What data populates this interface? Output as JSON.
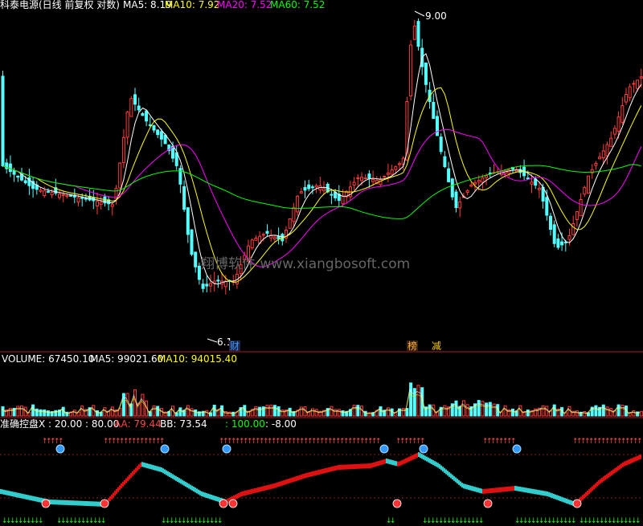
{
  "header": {
    "main_title": "科泰电源(日线 前复权 对数)",
    "ma": [
      {
        "label": "MA5: 8.19",
        "color": "#ffffff"
      },
      {
        "label": "MA10: 7.92",
        "color": "#ffff00"
      },
      {
        "label": "MA20: 7.52",
        "color": "#ff00ff"
      },
      {
        "label": "MA60: 7.52",
        "color": "#00ff00"
      }
    ]
  },
  "volume_header": {
    "volume": "VOLUME: 67450.10",
    "ma5": "MA5: 99021.60",
    "ma10": "MA10: 94015.40"
  },
  "indicator_header": {
    "name": "准确控盘X : 20.00 : 80.00",
    "aa": "AA: 79.44",
    "bb": "BB: 73.54",
    "v1": ": 100.00",
    "v2": ": -8.00"
  },
  "annotations": {
    "high_label": "9.00",
    "low_label": "6.1",
    "watermark": "翔博软件 www.xiangbosoft.com",
    "markers": [
      {
        "text": "财",
        "color": "#3399ff"
      },
      {
        "text": "榜",
        "color": "#ffaa33"
      },
      {
        "text": "减",
        "color": "#ffcc00"
      }
    ]
  },
  "chart_data": {
    "type": "candlestick",
    "title": "科泰电源(日线 前复权 对数)",
    "log_scale": true,
    "price_high": 9.0,
    "price_low": 6.1,
    "last_ma": {
      "MA5": 8.19,
      "MA10": 7.92,
      "MA20": 7.52,
      "MA60": 7.52
    },
    "last_volume": 67450.1,
    "volume_ma": {
      "MA5": 99021.6,
      "MA10": 94015.4
    },
    "indicator": {
      "name": "准确控盘X",
      "levels": [
        20.0,
        80.0
      ],
      "AA": 79.44,
      "BB": 73.54,
      "v1": 100.0,
      "v2": -8.0
    },
    "colors": {
      "up": "#ff3b3b",
      "down": "#54ffff",
      "ma5": "#ffffff",
      "ma10": "#ffff00",
      "ma20": "#ff00ff",
      "ma60": "#00ff00"
    }
  }
}
